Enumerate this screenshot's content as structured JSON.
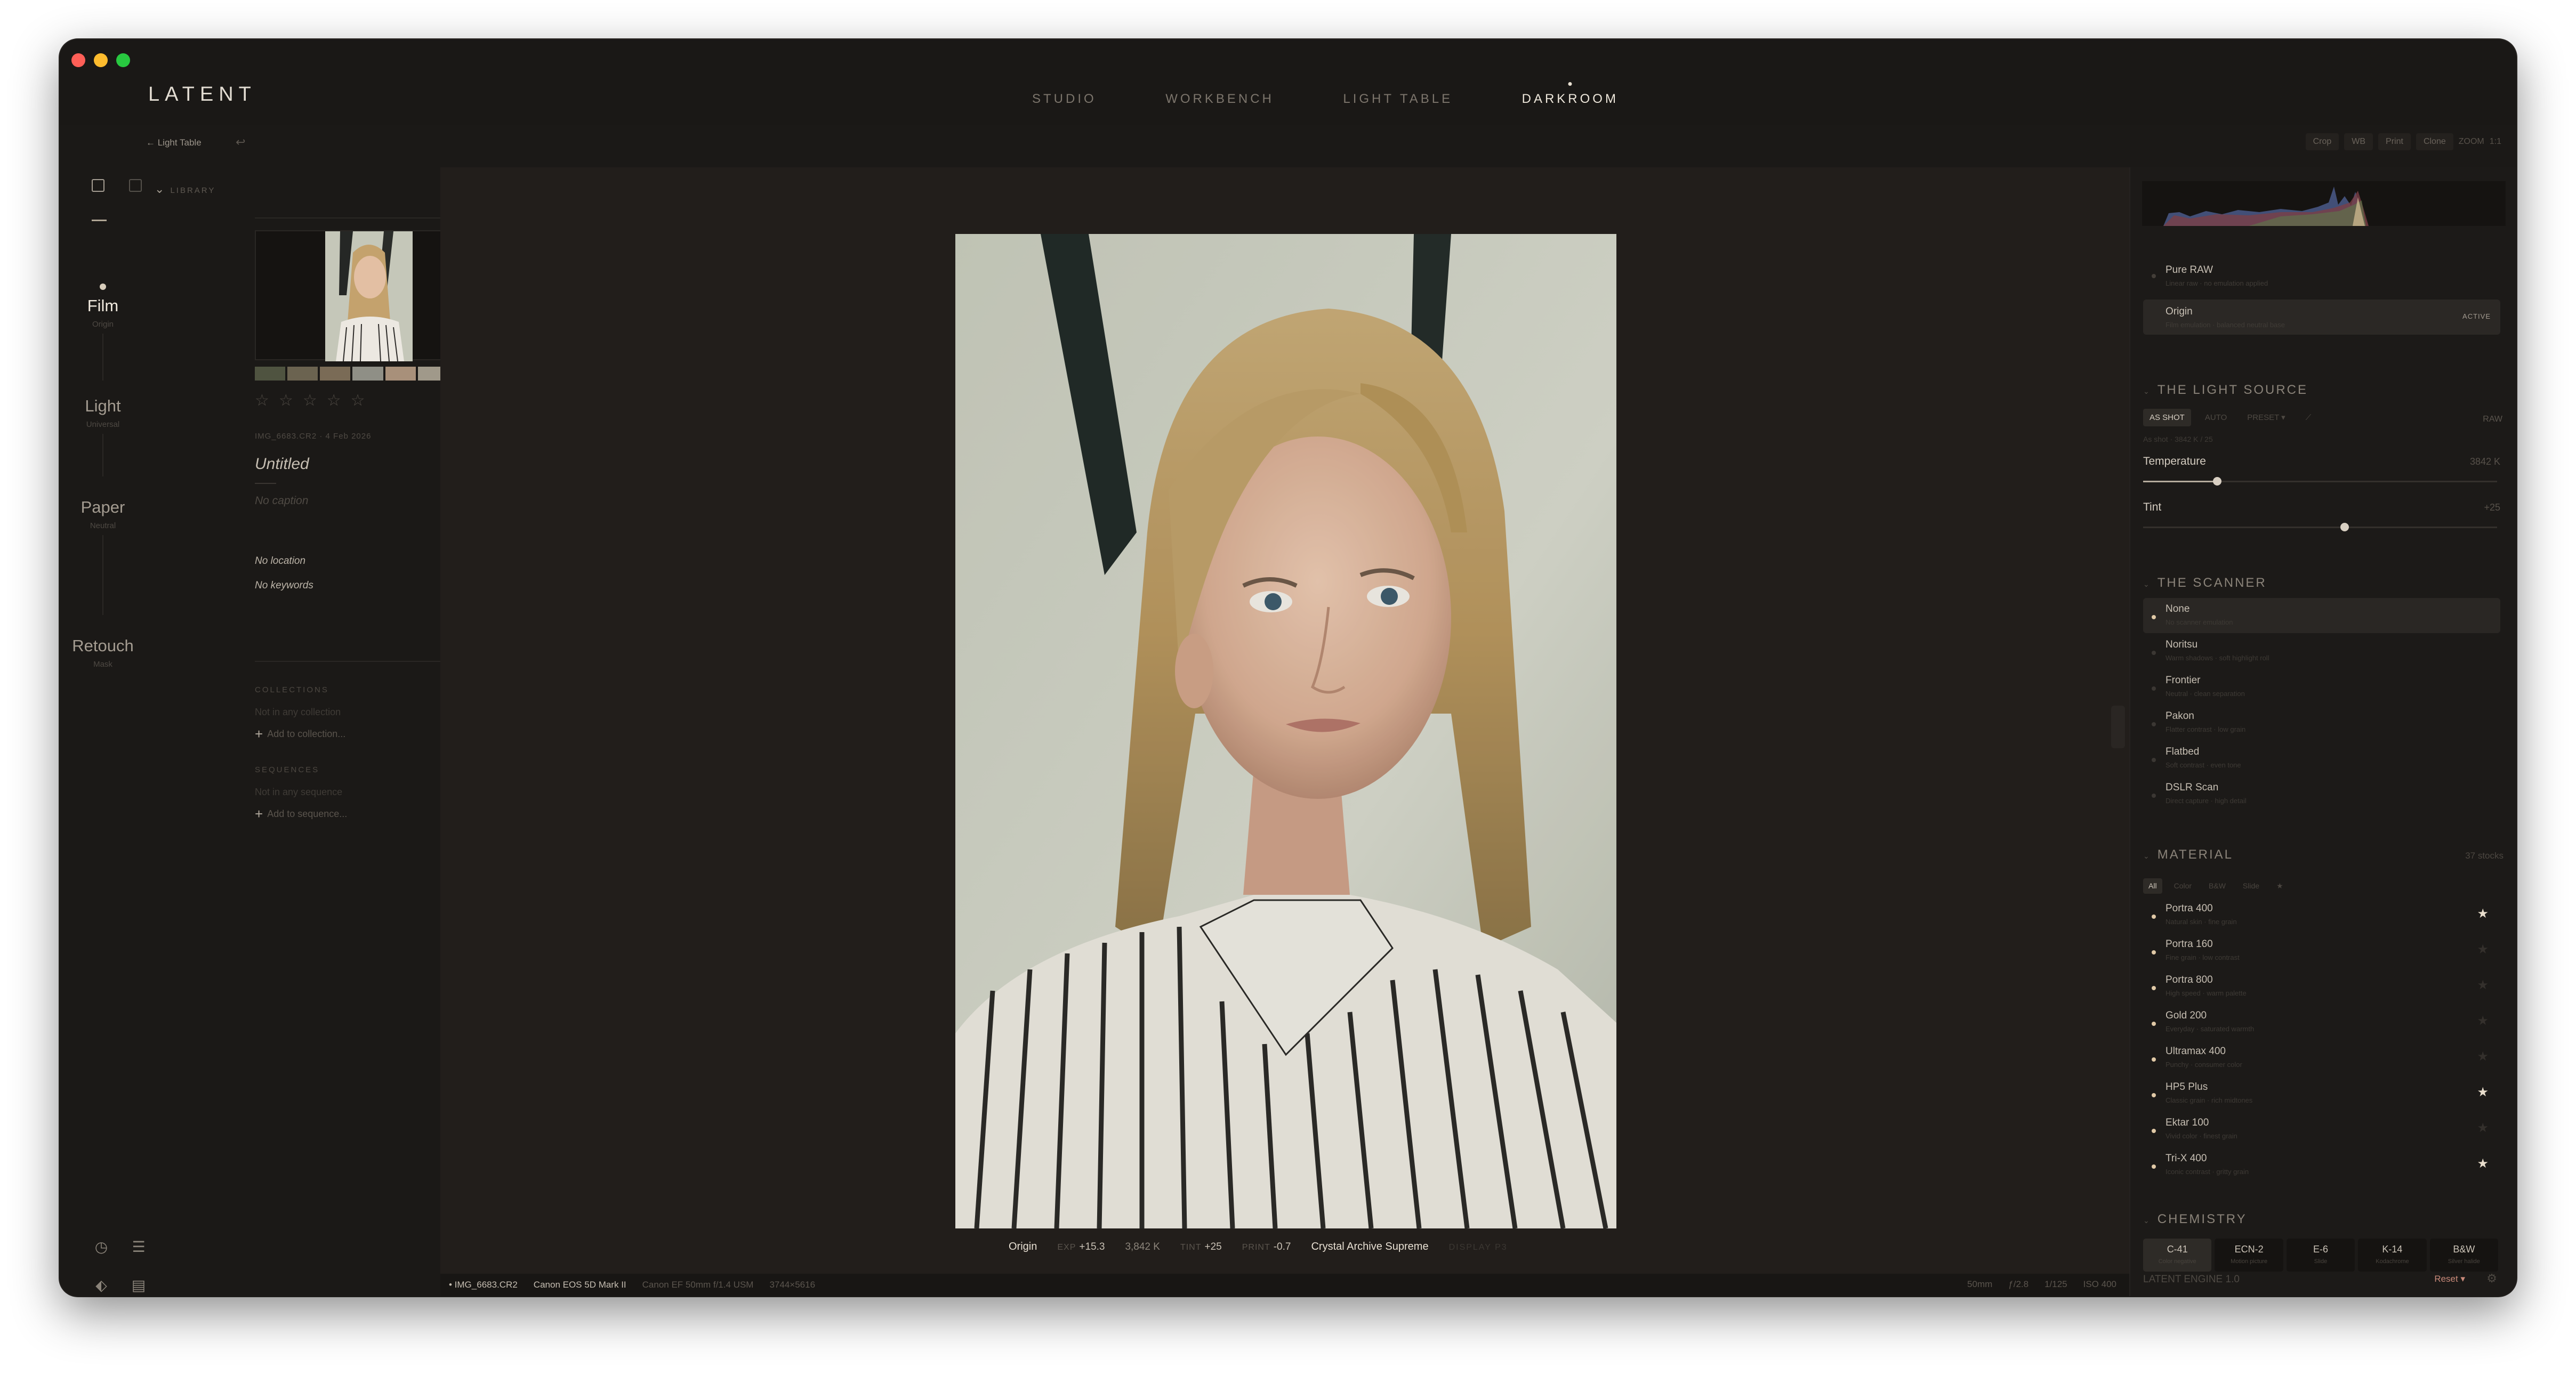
{
  "app": {
    "brand": "LATENT",
    "modes": [
      "STUDIO",
      "WORKBENCH",
      "LIGHT TABLE",
      "DARKROOM"
    ],
    "active_mode": "DARKROOM",
    "back_label": "← Light Table",
    "undo_glyph": "↩",
    "toolbar": {
      "crop": "Crop",
      "wb": "WB",
      "print": "Print",
      "clone": "Clone",
      "zoom_label": "ZOOM",
      "zoom_value": "1:1"
    }
  },
  "rail": {
    "stages": [
      {
        "name": "Film",
        "sub": "Origin"
      },
      {
        "name": "Light",
        "sub": "Universal"
      },
      {
        "name": "Paper",
        "sub": "Neutral"
      },
      {
        "name": "Retouch",
        "sub": "Mask"
      }
    ],
    "active_stage": "Film",
    "bottom_icons": [
      "history-icon",
      "sliders-icon",
      "tag-icon",
      "film-icon",
      "help-icon",
      "share-icon"
    ],
    "bottom_glyphs": [
      "◷",
      "☰",
      "⬖",
      "▤",
      "?",
      "⇪"
    ]
  },
  "library": {
    "header": "LIBRARY",
    "swatch_colors": [
      "#4f5340",
      "#6b6350",
      "#7a6b56",
      "#8f8f86",
      "#a8907a",
      "#a0998a",
      "#c7bfae"
    ],
    "stars": [
      "☆",
      "☆",
      "☆",
      "☆",
      "☆"
    ],
    "meta": "IMG_6683.CR2 · 4 Feb 2026",
    "title": "Untitled",
    "caption": "No caption",
    "location": "No location",
    "keywords": "No keywords",
    "collections_label": "COLLECTIONS",
    "collections_empty": "Not in any collection",
    "add_collection": "Add to collection...",
    "sequences_label": "SEQUENCES",
    "sequences_empty": "Not in any sequence",
    "add_sequence": "Add to sequence..."
  },
  "viewer": {
    "info": {
      "preset": "Origin",
      "exp_label": "EXP",
      "exp_value": "+15.3",
      "temp": "3,842 K",
      "tint_label": "TINT",
      "tint_value": "+25",
      "print_label": "PRINT",
      "print_value": "-0.7",
      "paper": "Crystal Archive Supreme",
      "display": "DISPLAY P3"
    },
    "status": {
      "file": "• IMG_6683.CR2",
      "camera": "Canon EOS 5D Mark II",
      "lens": "Canon EF 50mm f/1.4 USM",
      "dims": "3744×5616",
      "focal": "50mm",
      "aperture": "ƒ/2.8",
      "shutter": "1/125",
      "iso": "ISO 400"
    }
  },
  "right_panel": {
    "presets": [
      {
        "name": "Pure RAW",
        "desc": "Linear raw · no emulation applied",
        "selected": false
      },
      {
        "name": "Origin",
        "desc": "Film emulation · balanced neutral base",
        "selected": true,
        "badge": "ACTIVE"
      }
    ],
    "light_source": {
      "title": "THE LIGHT SOURCE",
      "tabs": [
        "AS SHOT",
        "AUTO",
        "PRESET ▾"
      ],
      "active_tab": "AS SHOT",
      "picker_glyph": "⟋",
      "raw_label": "RAW",
      "sub": "As shot · 3842 K / 25",
      "temperature_label": "Temperature",
      "temperature_value": "3842 K",
      "temperature_pos": 0.21,
      "tint_label": "Tint",
      "tint_value": "+25",
      "tint_pos": 0.57
    },
    "scanner": {
      "title": "THE SCANNER",
      "items": [
        {
          "name": "None",
          "desc": "No scanner emulation",
          "selected": true
        },
        {
          "name": "Noritsu",
          "desc": "Warm shadows · soft highlight roll",
          "selected": false
        },
        {
          "name": "Frontier",
          "desc": "Neutral · clean separation",
          "selected": false
        },
        {
          "name": "Pakon",
          "desc": "Flatter contrast · low grain",
          "selected": false
        },
        {
          "name": "Flatbed",
          "desc": "Soft contrast · even tone",
          "selected": false
        },
        {
          "name": "DSLR Scan",
          "desc": "Direct capture · high detail",
          "selected": false
        }
      ]
    },
    "material": {
      "title": "MATERIAL",
      "count": "37 stocks",
      "tabs": [
        "All",
        "Color",
        "B&W",
        "Slide",
        "★"
      ],
      "active_tab": "All",
      "items": [
        {
          "name": "Portra 400",
          "desc": "Natural skin · fine grain",
          "fav": true
        },
        {
          "name": "Portra 160",
          "desc": "Fine grain · low contrast",
          "fav": false
        },
        {
          "name": "Portra 800",
          "desc": "High speed · warm palette",
          "fav": false
        },
        {
          "name": "Gold 200",
          "desc": "Everyday · saturated warmth",
          "fav": false
        },
        {
          "name": "Ultramax 400",
          "desc": "Punchy · consumer color",
          "fav": false
        },
        {
          "name": "HP5 Plus",
          "desc": "Classic grain · rich midtones",
          "fav": true
        },
        {
          "name": "Ektar 100",
          "desc": "Vivid color · finest grain",
          "fav": false
        },
        {
          "name": "Tri-X 400",
          "desc": "Iconic contrast · gritty grain",
          "fav": true
        }
      ]
    },
    "chemistry": {
      "title": "CHEMISTRY",
      "items": [
        {
          "name": "C-41",
          "sub": "Color negative",
          "active": true
        },
        {
          "name": "ECN-2",
          "sub": "Motion picture",
          "active": false
        },
        {
          "name": "E-6",
          "sub": "Slide",
          "active": false
        },
        {
          "name": "K-14",
          "sub": "Kodachrome",
          "active": false
        },
        {
          "name": "B&W",
          "sub": "Silver halide",
          "active": false
        }
      ]
    },
    "footer": {
      "engine": "LATENT ENGINE 1.0",
      "reset": "Reset ▾",
      "gear": "⚙"
    }
  },
  "colors": {
    "accent": "#e0c9a6",
    "bg": "#1b1917",
    "canvas": "#221e1b",
    "reset": "#c98a7a"
  }
}
